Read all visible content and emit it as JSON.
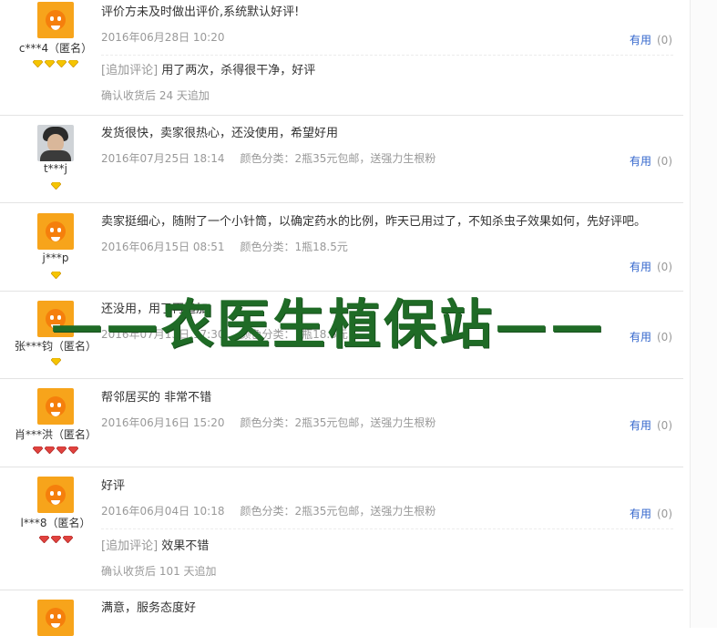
{
  "colors": {
    "link": "#3366cc",
    "meta": "#999999",
    "watermark": "#1f6b26",
    "avatar": "#f7a41b"
  },
  "reviews": [
    {
      "user": "c***4（匿名）",
      "avatar": "mascot",
      "badge": "diamond",
      "badge_count": 4,
      "content": "评价方未及时做出评价,系统默认好评!",
      "date": "2016年06月28日 10:20",
      "sku": "",
      "useful_label": "有用",
      "useful_count": "(0)",
      "append_tag": "[追加评论]",
      "append_text": "用了两次，杀得很干净，好评",
      "append_time": "确认收货后 24 天追加"
    },
    {
      "user": "t***j",
      "avatar": "photo",
      "badge": "diamond",
      "badge_count": 1,
      "content": "发货很快，卖家很热心，还没使用，希望好用",
      "date": "2016年07月25日 18:14",
      "sku": "颜色分类：2瓶35元包邮，送强力生根粉",
      "useful_label": "有用",
      "useful_count": "(0)"
    },
    {
      "user": "j***p",
      "avatar": "mascot",
      "badge": "diamond",
      "badge_count": 1,
      "content": "卖家挺细心，随附了一个小针筒，以确定药水的比例，昨天已用过了，不知杀虫子效果如何，先好评吧。",
      "date": "2016年06月15日 08:51",
      "sku": "颜色分类：1瓶18.5元",
      "useful_label": "有用",
      "useful_count": "(0)"
    },
    {
      "user": "张***钧（匿名）",
      "avatar": "mascot",
      "badge": "diamond",
      "badge_count": 1,
      "content": "还没用，用了再追加",
      "date": "2016年07月13日 17:30",
      "sku": "颜色分类：1瓶18.5元",
      "useful_label": "有用",
      "useful_count": "(0)"
    },
    {
      "user": "肖***洪（匿名）",
      "avatar": "mascot",
      "badge": "heart",
      "badge_count": 4,
      "content": "帮邻居买的 非常不错",
      "date": "2016年06月16日 15:20",
      "sku": "颜色分类：2瓶35元包邮，送强力生根粉",
      "useful_label": "有用",
      "useful_count": "(0)"
    },
    {
      "user": "l***8（匿名）",
      "avatar": "mascot",
      "badge": "heart",
      "badge_count": 3,
      "content": "好评",
      "date": "2016年06月04日 10:18",
      "sku": "颜色分类：2瓶35元包邮，送强力生根粉",
      "useful_label": "有用",
      "useful_count": "(0)",
      "append_tag": "[追加评论]",
      "append_text": "效果不错",
      "append_time": "确认收货后 101 天追加"
    },
    {
      "user": "",
      "avatar": "mascot",
      "badge": "",
      "badge_count": 0,
      "content": "满意，服务态度好",
      "date": "",
      "sku": "",
      "useful_label": "",
      "useful_count": ""
    }
  ],
  "watermark": "——农医生植保站——"
}
